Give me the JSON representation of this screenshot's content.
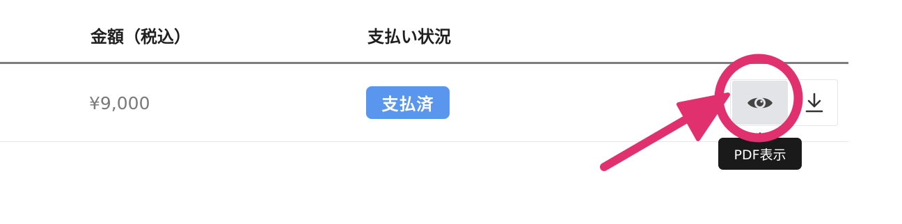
{
  "table": {
    "headers": {
      "amount": "金額（税込）",
      "status": "支払い状況"
    },
    "rows": [
      {
        "amount": "¥9,000",
        "status": "支払済"
      }
    ]
  },
  "actions": {
    "view_icon": "eye-icon",
    "download_icon": "download-icon"
  },
  "tooltip": {
    "label": "PDF表示"
  },
  "colors": {
    "badge": "#5a95ee",
    "annotation": "#e0306e",
    "tooltip_bg": "#1a1a1a",
    "header_rule": "#7b7b80"
  }
}
